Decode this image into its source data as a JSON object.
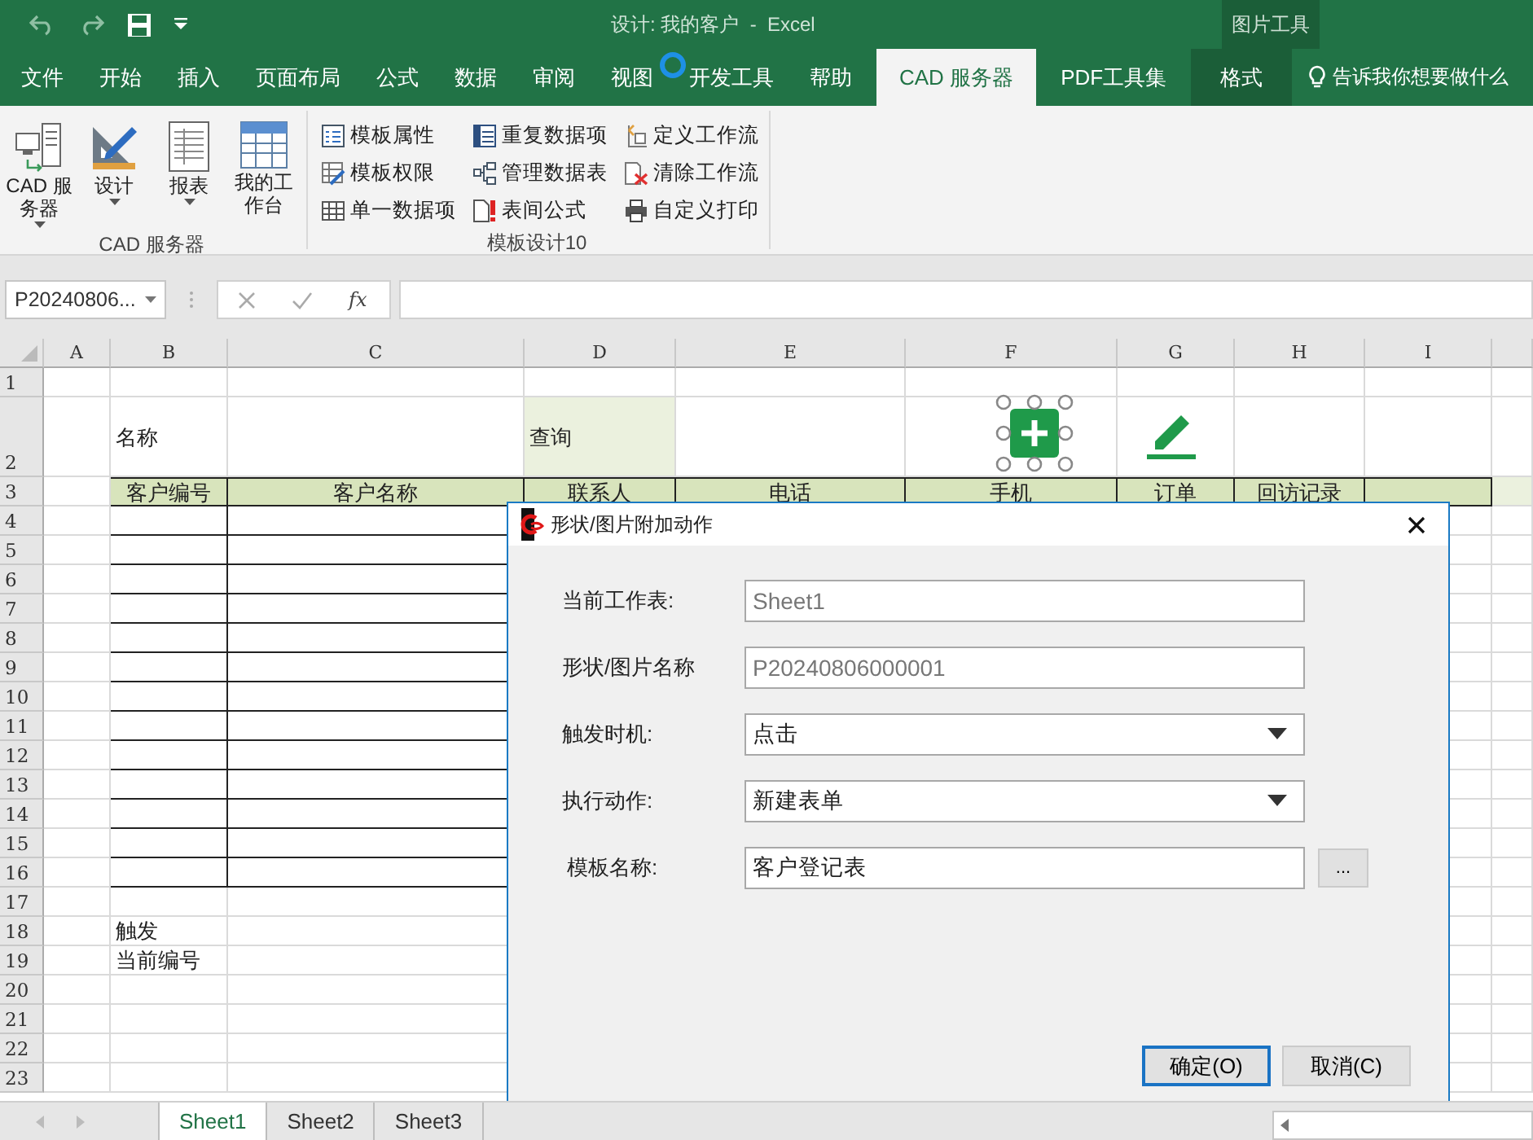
{
  "window": {
    "title": "设计: 我的客户  -  Excel",
    "context_label": "图片工具"
  },
  "tabs": [
    {
      "label": "文件",
      "selected": false,
      "kind": "normal"
    },
    {
      "label": "开始",
      "selected": false,
      "kind": "normal"
    },
    {
      "label": "插入",
      "selected": false,
      "kind": "normal"
    },
    {
      "label": "页面布局",
      "selected": false,
      "kind": "normal"
    },
    {
      "label": "公式",
      "selected": false,
      "kind": "normal"
    },
    {
      "label": "数据",
      "selected": false,
      "kind": "normal"
    },
    {
      "label": "审阅",
      "selected": false,
      "kind": "normal"
    },
    {
      "label": "视图",
      "selected": false,
      "kind": "normal"
    },
    {
      "label": "开发工具",
      "selected": false,
      "kind": "normal"
    },
    {
      "label": "帮助",
      "selected": false,
      "kind": "normal"
    },
    {
      "label": "CAD 服务器",
      "selected": true,
      "kind": "normal"
    },
    {
      "label": "PDF工具集",
      "selected": false,
      "kind": "normal"
    },
    {
      "label": "格式",
      "selected": false,
      "kind": "contextual"
    }
  ],
  "tell_me": "告诉我你想要做什么",
  "ribbon": {
    "groups": [
      {
        "label": "CAD 服务器",
        "large_buttons": [
          {
            "label": "CAD 服务器",
            "dropdown": true
          },
          {
            "label": "设计",
            "dropdown": true
          },
          {
            "label": "报表",
            "dropdown": true
          },
          {
            "label": "我的工作台",
            "dropdown": false
          }
        ]
      },
      {
        "label": "模板设计10",
        "small_buttons": [
          {
            "label": "模板属性"
          },
          {
            "label": "模板权限"
          },
          {
            "label": "单一数据项"
          },
          {
            "label": "重复数据项"
          },
          {
            "label": "管理数据表"
          },
          {
            "label": "表间公式"
          },
          {
            "label": "定义工作流"
          },
          {
            "label": "清除工作流"
          },
          {
            "label": "自定义打印"
          }
        ]
      }
    ]
  },
  "formula_bar": {
    "name_box": "P20240806...",
    "fx": "fx"
  },
  "sheet": {
    "columns": [
      "A",
      "B",
      "C",
      "D",
      "E",
      "F",
      "G",
      "H",
      "I"
    ],
    "rows": [
      {
        "number": "1",
        "kind": "plain",
        "cells": [
          "",
          "",
          "",
          "",
          "",
          "",
          "",
          "",
          ""
        ]
      },
      {
        "number": "2",
        "kind": "tall",
        "cells": [
          "",
          "名称",
          "",
          "查询",
          "",
          "",
          "",
          "",
          ""
        ],
        "shaded": [
          false,
          false,
          false,
          true,
          false,
          false,
          false,
          false,
          false
        ]
      },
      {
        "number": "3",
        "kind": "header",
        "cells": [
          "",
          "客户编号",
          "客户名称",
          "联系人",
          "电话",
          "手机",
          "订单",
          "回访记录",
          ""
        ],
        "shaded": [
          false,
          true,
          true,
          true,
          true,
          true,
          true,
          true,
          true
        ]
      },
      {
        "number": "4",
        "kind": "plain",
        "cells": [
          "",
          "",
          "",
          "",
          "",
          "",
          "",
          "",
          ""
        ],
        "boxed": [
          false,
          true,
          true,
          false,
          false,
          false,
          false,
          false,
          false
        ]
      },
      {
        "number": "5",
        "kind": "plain",
        "cells": [
          "",
          "",
          "",
          "",
          "",
          "",
          "",
          "",
          ""
        ],
        "boxed": [
          false,
          true,
          true,
          false,
          false,
          false,
          false,
          false,
          false
        ]
      },
      {
        "number": "6",
        "kind": "plain",
        "cells": [
          "",
          "",
          "",
          "",
          "",
          "",
          "",
          "",
          ""
        ],
        "boxed": [
          false,
          true,
          true,
          false,
          false,
          false,
          false,
          false,
          false
        ]
      },
      {
        "number": "7",
        "kind": "plain",
        "cells": [
          "",
          "",
          "",
          "",
          "",
          "",
          "",
          "",
          ""
        ],
        "boxed": [
          false,
          true,
          true,
          false,
          false,
          false,
          false,
          false,
          false
        ]
      },
      {
        "number": "8",
        "kind": "plain",
        "cells": [
          "",
          "",
          "",
          "",
          "",
          "",
          "",
          "",
          ""
        ],
        "boxed": [
          false,
          true,
          true,
          false,
          false,
          false,
          false,
          false,
          false
        ]
      },
      {
        "number": "9",
        "kind": "plain",
        "cells": [
          "",
          "",
          "",
          "",
          "",
          "",
          "",
          "",
          ""
        ],
        "boxed": [
          false,
          true,
          true,
          false,
          false,
          false,
          false,
          false,
          false
        ]
      },
      {
        "number": "10",
        "kind": "plain",
        "cells": [
          "",
          "",
          "",
          "",
          "",
          "",
          "",
          "",
          ""
        ],
        "boxed": [
          false,
          true,
          true,
          false,
          false,
          false,
          false,
          false,
          false
        ]
      },
      {
        "number": "11",
        "kind": "plain",
        "cells": [
          "",
          "",
          "",
          "",
          "",
          "",
          "",
          "",
          ""
        ],
        "boxed": [
          false,
          true,
          true,
          false,
          false,
          false,
          false,
          false,
          false
        ]
      },
      {
        "number": "12",
        "kind": "plain",
        "cells": [
          "",
          "",
          "",
          "",
          "",
          "",
          "",
          "",
          ""
        ],
        "boxed": [
          false,
          true,
          true,
          false,
          false,
          false,
          false,
          false,
          false
        ]
      },
      {
        "number": "13",
        "kind": "plain",
        "cells": [
          "",
          "",
          "",
          "",
          "",
          "",
          "",
          "",
          ""
        ],
        "boxed": [
          false,
          true,
          true,
          false,
          false,
          false,
          false,
          false,
          false
        ]
      },
      {
        "number": "14",
        "kind": "plain",
        "cells": [
          "",
          "",
          "",
          "",
          "",
          "",
          "",
          "",
          ""
        ],
        "boxed": [
          false,
          true,
          true,
          false,
          false,
          false,
          false,
          false,
          false
        ]
      },
      {
        "number": "15",
        "kind": "plain",
        "cells": [
          "",
          "",
          "",
          "",
          "",
          "",
          "",
          "",
          ""
        ],
        "boxed": [
          false,
          true,
          true,
          false,
          false,
          false,
          false,
          false,
          false
        ]
      },
      {
        "number": "16",
        "kind": "plain",
        "cells": [
          "",
          "",
          "",
          "",
          "",
          "",
          "",
          "",
          ""
        ],
        "boxed": [
          false,
          true,
          true,
          false,
          false,
          false,
          false,
          false,
          false
        ]
      },
      {
        "number": "17",
        "kind": "plain",
        "cells": [
          "",
          "",
          "",
          "",
          "",
          "",
          "",
          "",
          ""
        ]
      },
      {
        "number": "18",
        "kind": "plain",
        "cells": [
          "",
          "触发",
          "",
          "",
          "",
          "",
          "",
          "",
          ""
        ]
      },
      {
        "number": "19",
        "kind": "plain",
        "cells": [
          "",
          "当前编号",
          "",
          "",
          "",
          "",
          "",
          "",
          ""
        ]
      },
      {
        "number": "20",
        "kind": "plain",
        "cells": [
          "",
          "",
          "",
          "",
          "",
          "",
          "",
          "",
          ""
        ]
      },
      {
        "number": "21",
        "kind": "plain",
        "cells": [
          "",
          "",
          "",
          "",
          "",
          "",
          "",
          "",
          ""
        ]
      },
      {
        "number": "22",
        "kind": "plain",
        "cells": [
          "",
          "",
          "",
          "",
          "",
          "",
          "",
          "",
          ""
        ]
      },
      {
        "number": "23",
        "kind": "plain",
        "cells": [
          "",
          "",
          "",
          "",
          "",
          "",
          "",
          "",
          ""
        ]
      }
    ],
    "shapes": [
      {
        "kind": "add",
        "selected": true
      },
      {
        "kind": "pencil",
        "selected": false
      }
    ]
  },
  "sheet_tabs": [
    {
      "label": "Sheet1",
      "selected": true
    },
    {
      "label": "Sheet2",
      "selected": false
    },
    {
      "label": "Sheet3",
      "selected": false
    }
  ],
  "dialog": {
    "title": "形状/图片附加动作",
    "fields": [
      {
        "label": "当前工作表:",
        "kind": "readonly",
        "value": "Sheet1"
      },
      {
        "label": "形状/图片名称",
        "kind": "readonly",
        "value": "P20240806000001"
      },
      {
        "label": "触发时机:",
        "kind": "dropdown",
        "value": "点击"
      },
      {
        "label": "执行动作:",
        "kind": "dropdown",
        "value": "新建表单"
      },
      {
        "label": "模板名称:",
        "kind": "browse",
        "value": "客户登记表",
        "button": "..."
      }
    ],
    "buttons": [
      {
        "label": "确定(O)",
        "default": true
      },
      {
        "label": "取消(C)",
        "default": false
      }
    ]
  }
}
